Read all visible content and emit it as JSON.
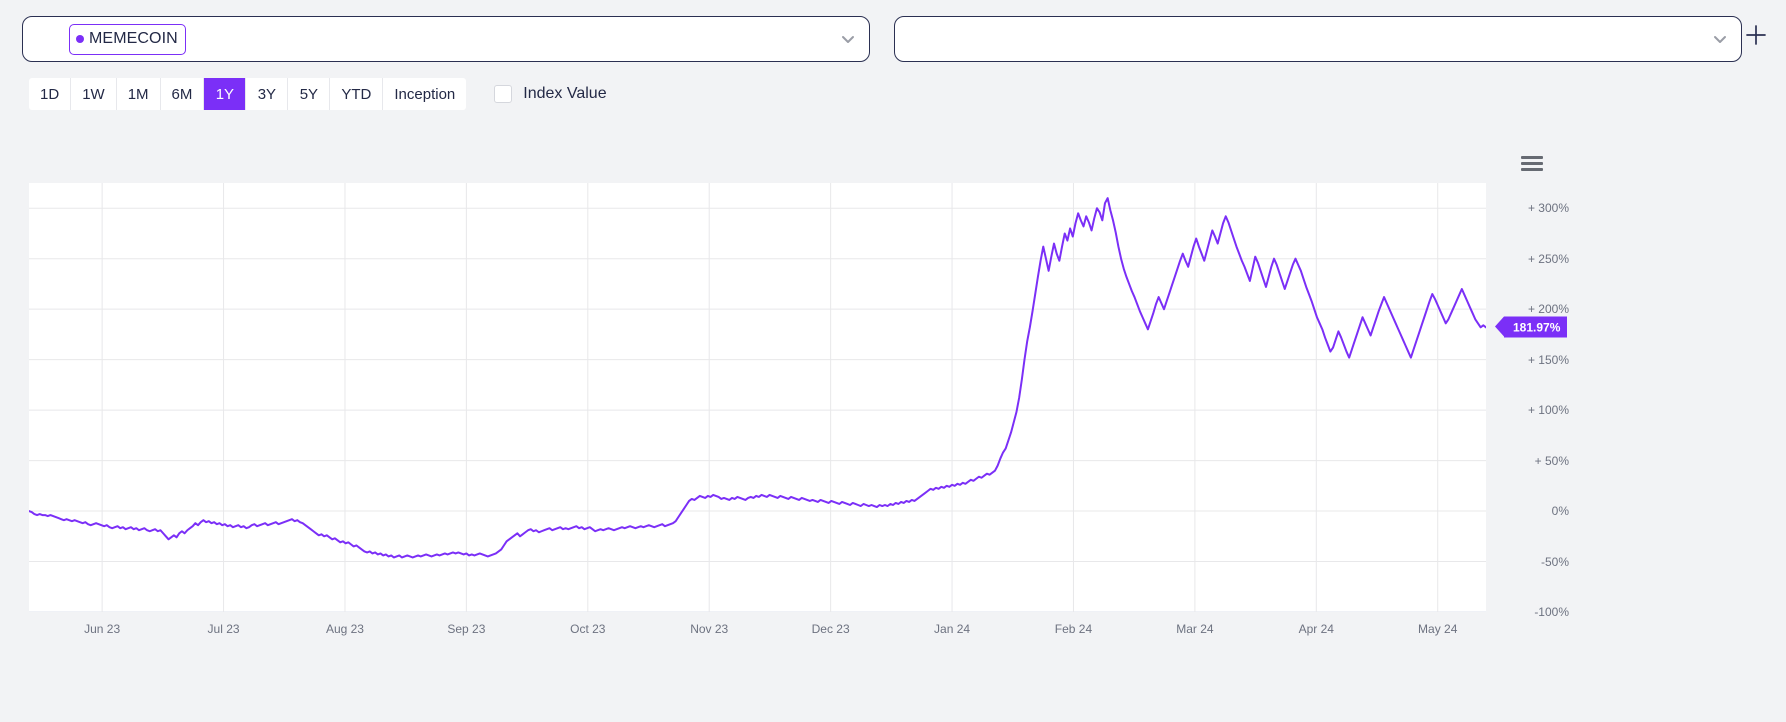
{
  "selectors": {
    "primary": {
      "name": "asset-select",
      "chip_label": "MEMECOIN",
      "chip_color": "#7b2ff7",
      "chevron_icon": "chevron-down-icon"
    },
    "secondary": {
      "name": "comparison-select",
      "value": "",
      "chevron_icon": "chevron-down-icon"
    },
    "add_button_icon": "plus-icon"
  },
  "range_controls": {
    "buttons": [
      {
        "label": "1D",
        "active": false
      },
      {
        "label": "1W",
        "active": false
      },
      {
        "label": "1M",
        "active": false
      },
      {
        "label": "6M",
        "active": false
      },
      {
        "label": "1Y",
        "active": true
      },
      {
        "label": "3Y",
        "active": false
      },
      {
        "label": "5Y",
        "active": false
      },
      {
        "label": "YTD",
        "active": false
      },
      {
        "label": "Inception",
        "active": false
      }
    ],
    "active_color": "#7b2ff7",
    "index_value": {
      "label": "Index Value",
      "checked": false
    }
  },
  "chart_menu": {
    "icon": "hamburger-menu-icon"
  },
  "chart_data": {
    "type": "line",
    "title": "",
    "xlabel": "",
    "ylabel": "",
    "series_name": "MEMECOIN",
    "line_color": "#7b2ff7",
    "grid": true,
    "legend_position": "none",
    "ylim": [
      -100,
      325
    ],
    "y_ticks": [
      300,
      250,
      200,
      150,
      100,
      50,
      0,
      -50,
      -100
    ],
    "y_tick_labels": [
      "+ 300%",
      "+ 250%",
      "+ 200%",
      "+ 150%",
      "+ 100%",
      "+ 50%",
      "0%",
      "-50%",
      "-100%"
    ],
    "x_ticks": [
      "Jun 23",
      "Jul 23",
      "Aug 23",
      "Sep 23",
      "Oct 23",
      "Nov 23",
      "Dec 23",
      "Jan 24",
      "Feb 24",
      "Mar 24",
      "Apr 24",
      "May 24"
    ],
    "current_value_label": "181.97%",
    "current_value": 181.97,
    "values": [
      0,
      -1,
      -3,
      -4,
      -3,
      -4,
      -4,
      -5,
      -4,
      -5,
      -6,
      -7,
      -8,
      -9,
      -8,
      -9,
      -10,
      -9,
      -10,
      -11,
      -12,
      -11,
      -13,
      -14,
      -13,
      -12,
      -13,
      -14,
      -15,
      -14,
      -16,
      -17,
      -16,
      -15,
      -17,
      -16,
      -18,
      -17,
      -16,
      -18,
      -17,
      -19,
      -18,
      -17,
      -19,
      -20,
      -19,
      -18,
      -20,
      -19,
      -22,
      -25,
      -28,
      -26,
      -24,
      -26,
      -22,
      -20,
      -22,
      -19,
      -17,
      -15,
      -12,
      -14,
      -11,
      -9,
      -11,
      -10,
      -12,
      -11,
      -13,
      -12,
      -14,
      -13,
      -15,
      -14,
      -16,
      -15,
      -14,
      -16,
      -15,
      -17,
      -16,
      -14,
      -13,
      -15,
      -14,
      -13,
      -12,
      -14,
      -13,
      -12,
      -11,
      -13,
      -12,
      -11,
      -10,
      -9,
      -8,
      -10,
      -9,
      -11,
      -12,
      -14,
      -16,
      -18,
      -20,
      -22,
      -24,
      -23,
      -25,
      -24,
      -26,
      -28,
      -27,
      -29,
      -31,
      -30,
      -32,
      -31,
      -33,
      -35,
      -34,
      -36,
      -38,
      -40,
      -41,
      -40,
      -42,
      -41,
      -43,
      -42,
      -44,
      -43,
      -45,
      -44,
      -46,
      -45,
      -44,
      -46,
      -45,
      -44,
      -45,
      -46,
      -45,
      -44,
      -45,
      -44,
      -43,
      -44,
      -45,
      -44,
      -43,
      -44,
      -43,
      -42,
      -43,
      -42,
      -41,
      -42,
      -41,
      -42,
      -43,
      -42,
      -44,
      -43,
      -44,
      -43,
      -42,
      -43,
      -44,
      -45,
      -44,
      -43,
      -42,
      -40,
      -38,
      -34,
      -30,
      -28,
      -26,
      -24,
      -22,
      -25,
      -23,
      -21,
      -19,
      -18,
      -20,
      -19,
      -21,
      -20,
      -19,
      -18,
      -17,
      -19,
      -18,
      -17,
      -16,
      -18,
      -17,
      -18,
      -17,
      -16,
      -15,
      -17,
      -16,
      -18,
      -17,
      -16,
      -18,
      -20,
      -19,
      -18,
      -19,
      -18,
      -17,
      -18,
      -19,
      -18,
      -17,
      -16,
      -17,
      -16,
      -15,
      -16,
      -17,
      -16,
      -15,
      -16,
      -15,
      -14,
      -15,
      -16,
      -15,
      -14,
      -13,
      -15,
      -14,
      -13,
      -12,
      -10,
      -6,
      -2,
      2,
      6,
      10,
      12,
      11,
      13,
      15,
      14,
      13,
      15,
      14,
      16,
      15,
      14,
      12,
      13,
      12,
      11,
      13,
      12,
      14,
      13,
      12,
      11,
      13,
      14,
      13,
      15,
      14,
      16,
      15,
      14,
      16,
      15,
      14,
      13,
      15,
      14,
      13,
      12,
      14,
      13,
      12,
      11,
      13,
      12,
      11,
      10,
      11,
      10,
      9,
      11,
      10,
      9,
      8,
      10,
      9,
      8,
      7,
      9,
      8,
      7,
      6,
      8,
      7,
      6,
      5,
      7,
      6,
      5,
      6,
      5,
      4,
      6,
      5,
      6,
      5,
      7,
      6,
      8,
      7,
      9,
      8,
      10,
      9,
      11,
      10,
      12,
      14,
      16,
      18,
      20,
      22,
      21,
      23,
      22,
      24,
      23,
      25,
      24,
      26,
      25,
      27,
      26,
      28,
      27,
      29,
      31,
      30,
      32,
      34,
      33,
      35,
      37,
      36,
      38,
      40,
      45,
      52,
      58,
      62,
      70,
      78,
      88,
      98,
      112,
      130,
      150,
      168,
      182,
      198,
      215,
      232,
      248,
      262,
      250,
      238,
      252,
      265,
      255,
      248,
      262,
      275,
      268,
      280,
      272,
      285,
      295,
      288,
      282,
      292,
      286,
      278,
      290,
      300,
      296,
      288,
      305,
      310,
      298,
      288,
      276,
      262,
      250,
      240,
      232,
      225,
      218,
      212,
      205,
      198,
      192,
      186,
      180,
      188,
      196,
      205,
      212,
      206,
      200,
      208,
      216,
      224,
      232,
      240,
      248,
      255,
      248,
      242,
      252,
      262,
      270,
      262,
      255,
      248,
      258,
      268,
      278,
      272,
      265,
      275,
      285,
      292,
      286,
      278,
      270,
      262,
      255,
      248,
      242,
      235,
      228,
      240,
      252,
      246,
      238,
      230,
      222,
      232,
      242,
      250,
      244,
      236,
      228,
      220,
      228,
      236,
      244,
      250,
      244,
      238,
      230,
      222,
      215,
      208,
      200,
      192,
      186,
      180,
      172,
      165,
      158,
      162,
      170,
      178,
      172,
      165,
      158,
      152,
      160,
      168,
      176,
      184,
      192,
      186,
      180,
      174,
      182,
      190,
      198,
      205,
      212,
      206,
      200,
      194,
      188,
      182,
      176,
      170,
      164,
      158,
      152,
      160,
      168,
      176,
      184,
      192,
      200,
      208,
      215,
      210,
      204,
      198,
      192,
      186,
      190,
      196,
      202,
      208,
      214,
      220,
      214,
      208,
      202,
      196,
      190,
      186,
      182,
      184,
      181.97
    ]
  }
}
